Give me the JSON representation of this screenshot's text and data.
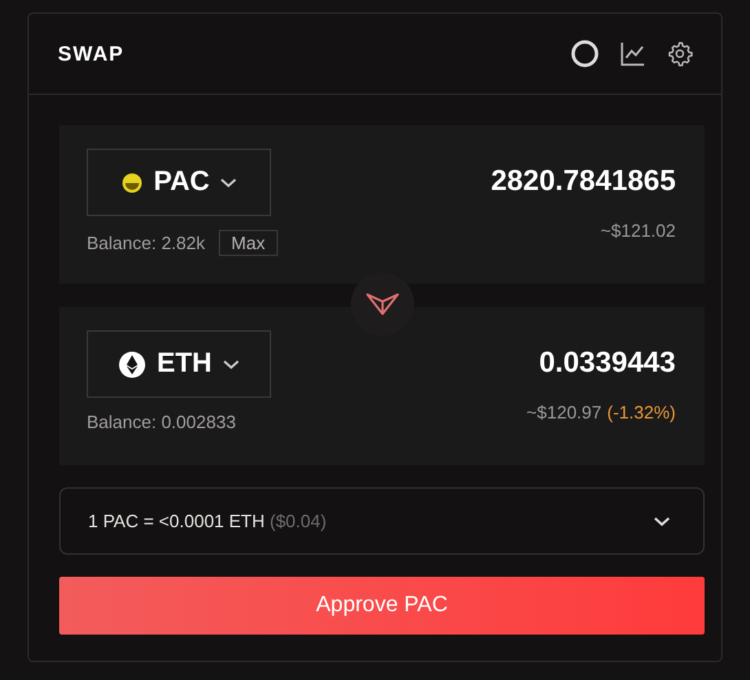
{
  "title": "SWAP",
  "tokens": [
    {
      "kind": "pac",
      "symbol": "PAC",
      "balance": "Balance: 2.82k",
      "max": "Max",
      "amount": "2820.7841865",
      "usd": "~$121.02"
    },
    {
      "kind": "eth",
      "symbol": "ETH",
      "balance": "Balance: 0.002833",
      "amount": "0.0339443",
      "usd": "~$120.97",
      "change": "(-1.32%)"
    }
  ],
  "rate": {
    "text": "1 PAC = <0.0001 ETH",
    "usd": "($0.04)"
  },
  "action": "Approve PAC"
}
